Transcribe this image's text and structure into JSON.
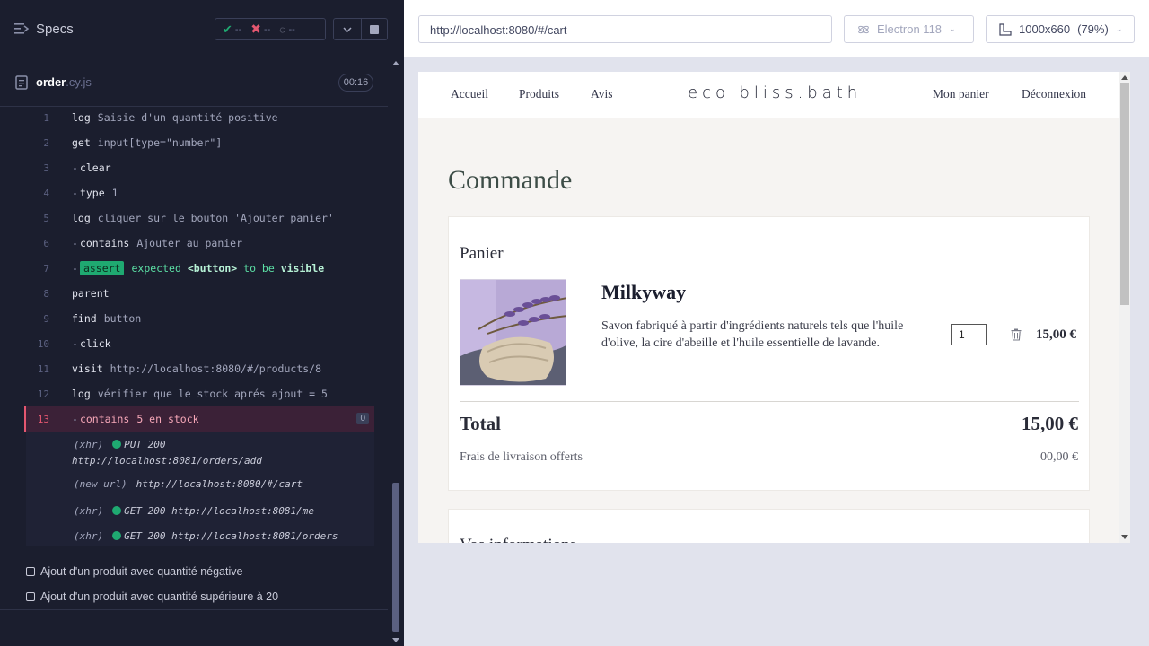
{
  "reporter": {
    "title": "Specs",
    "stats": {
      "passed": "--",
      "failed": "--",
      "pending": "--"
    },
    "spec_file": {
      "name": "order",
      "ext": ".cy.js",
      "duration": "00:16"
    },
    "commands": [
      {
        "num": "1",
        "name": "log",
        "msg": "Saisie d'un quantité positive",
        "child": false
      },
      {
        "num": "2",
        "name": "get",
        "msg": "input[type=\"number\"]",
        "child": false
      },
      {
        "num": "3",
        "name": "clear",
        "msg": "",
        "child": true
      },
      {
        "num": "4",
        "name": "type",
        "msg": "1",
        "child": true
      },
      {
        "num": "5",
        "name": "log",
        "msg": "cliquer sur le bouton 'Ajouter panier'",
        "child": false
      },
      {
        "num": "6",
        "name": "contains",
        "msg": "Ajouter au panier",
        "child": true
      },
      {
        "num": "7",
        "name": "assert",
        "msg_a": "expected",
        "msg_b": "<button>",
        "msg_c": "to be",
        "msg_d": "visible",
        "child": true
      },
      {
        "num": "8",
        "name": "parent",
        "msg": "",
        "child": false
      },
      {
        "num": "9",
        "name": "find",
        "msg": "button",
        "child": false
      },
      {
        "num": "10",
        "name": "click",
        "msg": "",
        "child": true
      },
      {
        "num": "11",
        "name": "visit",
        "msg": "http://localhost:8080/#/products/8",
        "child": false
      },
      {
        "num": "12",
        "name": "log",
        "msg": "vérifier que le stock aprés ajout = 5",
        "child": false
      },
      {
        "num": "13",
        "name": "contains",
        "msg": "5 en stock",
        "child": true,
        "count": "0"
      }
    ],
    "xhr": [
      {
        "tag": "(xhr)",
        "line1": "PUT 200",
        "line2": "http://localhost:8081/orders/add"
      },
      {
        "tag": "(new url)",
        "text": "http://localhost:8080/#/cart"
      },
      {
        "tag": "(xhr)",
        "text": "GET 200 http://localhost:8081/me"
      },
      {
        "tag": "(xhr)",
        "text": "GET 200 http://localhost:8081/orders"
      }
    ],
    "tests": [
      "Ajout d'un produit avec quantité négative",
      "Ajout d'un produit avec quantité supérieure à 20"
    ]
  },
  "aut": {
    "url": "http://localhost:8080/#/cart",
    "browser": "Electron 118",
    "viewport": "1000x660",
    "zoom": "(79%)"
  },
  "app": {
    "nav": {
      "home": "Accueil",
      "products": "Produits",
      "reviews": "Avis",
      "logo": "eco.bliss.bath",
      "cart": "Mon panier",
      "logout": "Déconnexion"
    },
    "heading": "Commande",
    "cart": {
      "title": "Panier",
      "product_name": "Milkyway",
      "product_desc": "Savon fabriqué à partir d'ingrédients naturels tels que l'huile d'olive, la cire d'abeille et l'huile essentielle de lavande.",
      "quantity": "1",
      "line_price": "15,00 €",
      "total_label": "Total",
      "total_value": "15,00 €",
      "shipping_label": "Frais de livraison offerts",
      "shipping_value": "00,00 €"
    },
    "info_title": "Vos informations"
  }
}
